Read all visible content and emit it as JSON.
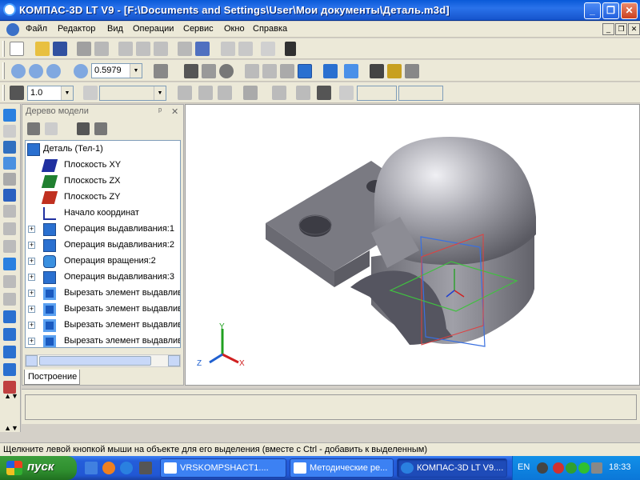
{
  "window": {
    "title": "КОМПАС-3D LT V9 - [F:\\Documents and Settings\\User\\Мои документы\\Деталь.m3d]",
    "min": "_",
    "max": "❐",
    "close": "✕"
  },
  "menu": [
    "Файл",
    "Редактор",
    "Вид",
    "Операции",
    "Сервис",
    "Окно",
    "Справка"
  ],
  "mdi": {
    "min": "_",
    "max": "❐",
    "close": "✕"
  },
  "toolbar2": {
    "zoom_value": "0.5979"
  },
  "toolbar3": {
    "step_value": "1.0"
  },
  "tree": {
    "title": "Дерево модели",
    "pin": "ᵖ",
    "close": "✕",
    "items": [
      {
        "label": "Деталь (Тел-1)"
      },
      {
        "label": "Плоскость XY"
      },
      {
        "label": "Плоскость ZX"
      },
      {
        "label": "Плоскость ZY"
      },
      {
        "label": "Начало координат"
      },
      {
        "label": "Операция выдавливания:1"
      },
      {
        "label": "Операция выдавливания:2"
      },
      {
        "label": "Операция вращения:2"
      },
      {
        "label": "Операция выдавливания:3"
      },
      {
        "label": "Вырезать элемент выдавливания"
      },
      {
        "label": "Вырезать элемент выдавливания"
      },
      {
        "label": "Вырезать элемент выдавливания"
      },
      {
        "label": "Вырезать элемент выдавливания"
      }
    ],
    "plus": "+",
    "tab": "Построение"
  },
  "axes": {
    "x": "X",
    "y": "Y",
    "z": "Z"
  },
  "status": "Щелкните левой кнопкой мыши на объекте для его выделения (вместе с Ctrl - добавить к выделенным)",
  "taskbar": {
    "start": "пуск",
    "tasks": [
      "VRSKOMPSHACT1....",
      "Методические ре...",
      "КОМПАС-3D LT V9...."
    ],
    "lang": "EN",
    "time": "18:33"
  },
  "colors": {
    "title_bg": "#0a5ad8",
    "taskbar": "#245edb",
    "start": "#2f8f2f",
    "part": "#8a8a92"
  }
}
